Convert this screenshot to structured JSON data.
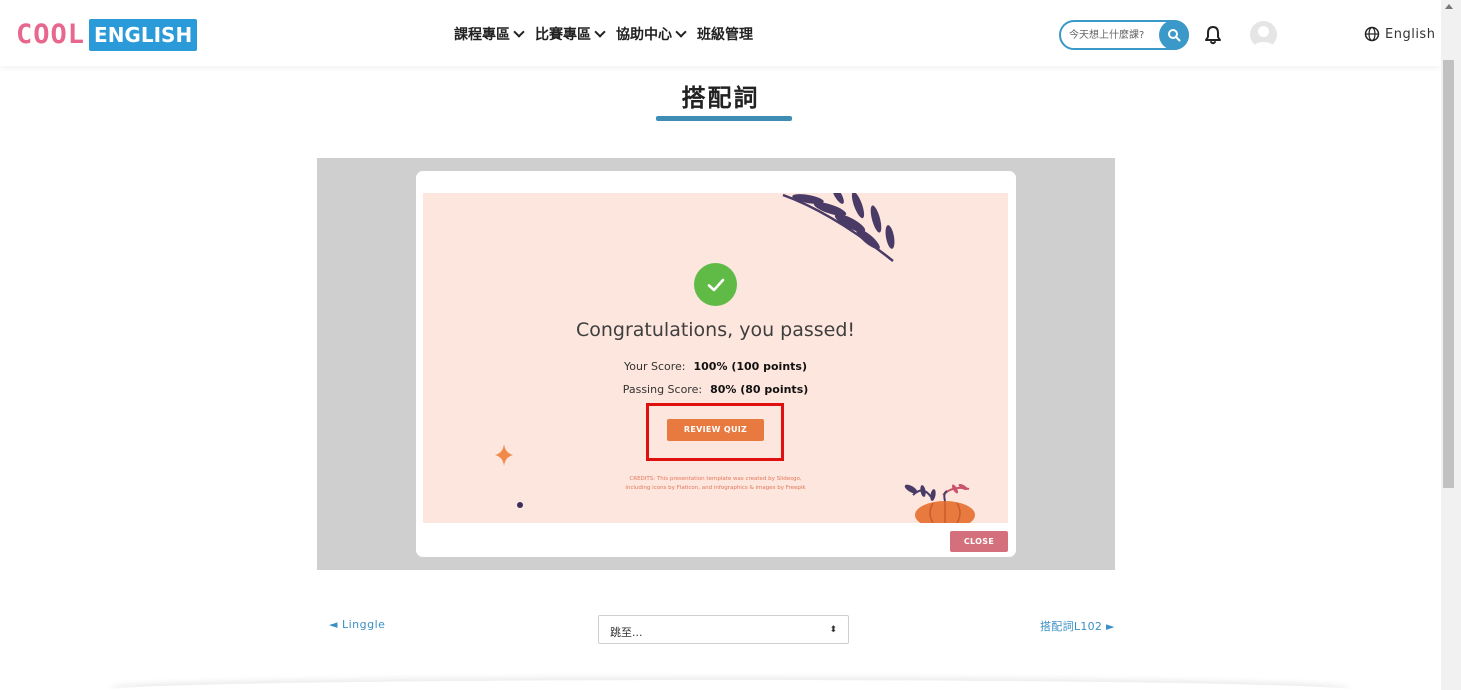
{
  "header": {
    "logo_part1": "COOL",
    "logo_part2": "ENGLISH",
    "nav": [
      {
        "label": "課程專區"
      },
      {
        "label": "比賽專區"
      },
      {
        "label": "協助中心"
      },
      {
        "label": "班級管理"
      }
    ],
    "search_placeholder": "今天想上什麼課?",
    "icons": {
      "search": "search-icon",
      "bell": "bell-icon",
      "avatar": "avatar-icon",
      "globe": "globe-icon"
    },
    "language": "English"
  },
  "page": {
    "title": "搭配詞",
    "accent_color": "#3f8db5"
  },
  "quiz_result": {
    "heading": "Congratulations, you passed!",
    "your_score_label": "Your Score:",
    "your_score_value": "100% (100 points)",
    "passing_score_label": "Passing Score:",
    "passing_score_value": "80% (80 points)",
    "review_button": "REVIEW QUIZ",
    "credits_line1": "CREDITS: This presentation template was created by Slidesgo,",
    "credits_line2": "including icons by Flaticon, and infographics & images by Freepik",
    "close_button": "CLOSE",
    "colors": {
      "slide_bg": "#fde6dd",
      "check": "#5fbb46",
      "review_btn": "#e8793f",
      "close_btn": "#d4707c",
      "highlight": "#e01010"
    }
  },
  "pager": {
    "prev_label": "◄ Linggle",
    "jump_placeholder": "跳至...",
    "next_label": "搭配詞L102 ►"
  }
}
